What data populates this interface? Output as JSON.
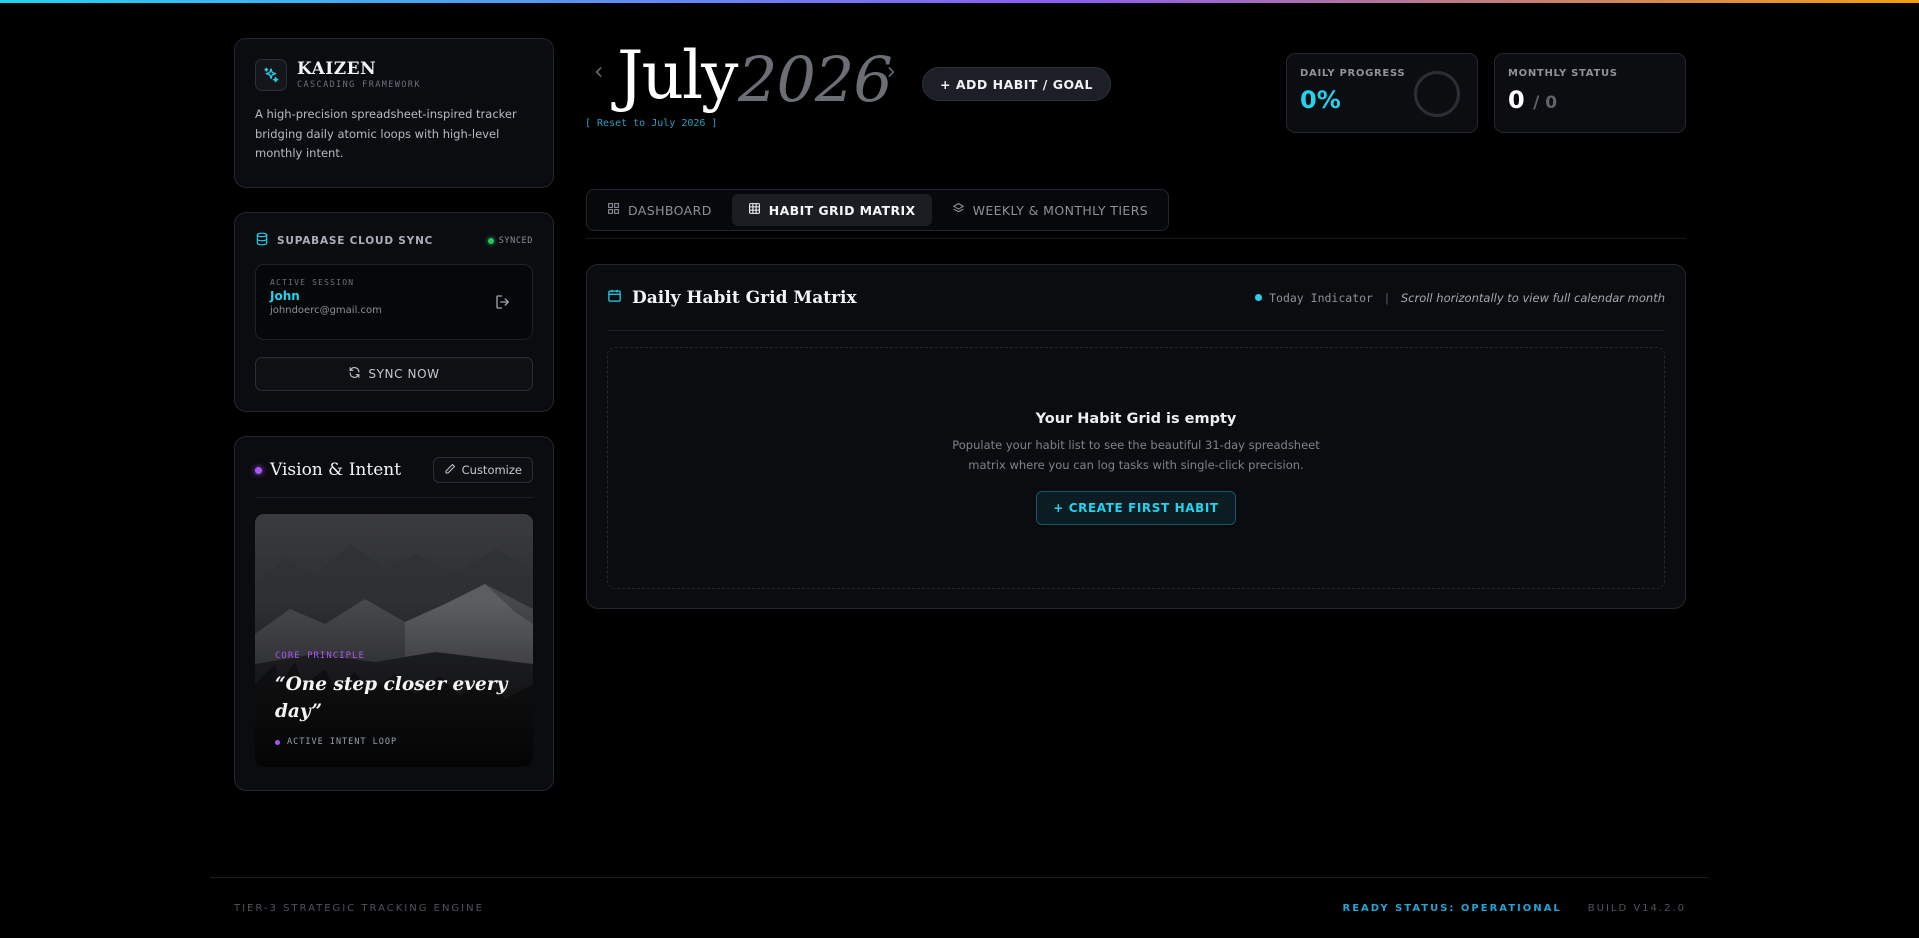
{
  "brand": {
    "title": "KAIZEN",
    "subtitle": "CASCADING FRAMEWORK",
    "description": "A high-precision spreadsheet-inspired tracker bridging daily atomic loops with high-level monthly intent.",
    "icon": "sparkles-icon"
  },
  "sync": {
    "title": "SUPABASE CLOUD SYNC",
    "status": "SYNCED",
    "session_label": "ACTIVE SESSION",
    "user_name": "John",
    "user_email": "johndoerc@gmail.com",
    "sync_button": "SYNC NOW"
  },
  "vision": {
    "title": "Vision & Intent",
    "customize": "Customize",
    "principle_label": "CORE PRINCIPLE",
    "quote": "“One step closer every day”",
    "loop_label": "ACTIVE INTENT LOOP"
  },
  "header": {
    "month": "July",
    "year": "2026",
    "reset": "[ Reset to July 2026 ]",
    "add_button": "+ ADD HABIT / GOAL"
  },
  "stats": {
    "daily_label": "DAILY PROGRESS",
    "daily_value": "0%",
    "monthly_label": "MONTHLY STATUS",
    "monthly_done": "0",
    "monthly_total": "/ 0"
  },
  "tabs": [
    {
      "label": "DASHBOARD",
      "icon": "grid-icon",
      "active": false
    },
    {
      "label": "HABIT GRID MATRIX",
      "icon": "table-icon",
      "active": true
    },
    {
      "label": "WEEKLY & MONTHLY TIERS",
      "icon": "layers-icon",
      "active": false
    }
  ],
  "matrix": {
    "title": "Daily Habit Grid Matrix",
    "today_indicator": "Today Indicator",
    "separator": "|",
    "hint": "Scroll horizontally to view full calendar month",
    "empty_title": "Your Habit Grid is empty",
    "empty_desc": "Populate your habit list to see the beautiful 31-day spreadsheet matrix where you can log tasks with single-click precision.",
    "create_button": "+ CREATE FIRST HABIT"
  },
  "footer": {
    "engine": "TIER-3 STRATEGIC TRACKING ENGINE",
    "status": "READY STATUS: OPERATIONAL",
    "build": "BUILD V14.2.0"
  },
  "colors": {
    "accent": "#22d3ee",
    "purple": "#a855f7",
    "success": "#22c55e",
    "background": "#000000"
  }
}
